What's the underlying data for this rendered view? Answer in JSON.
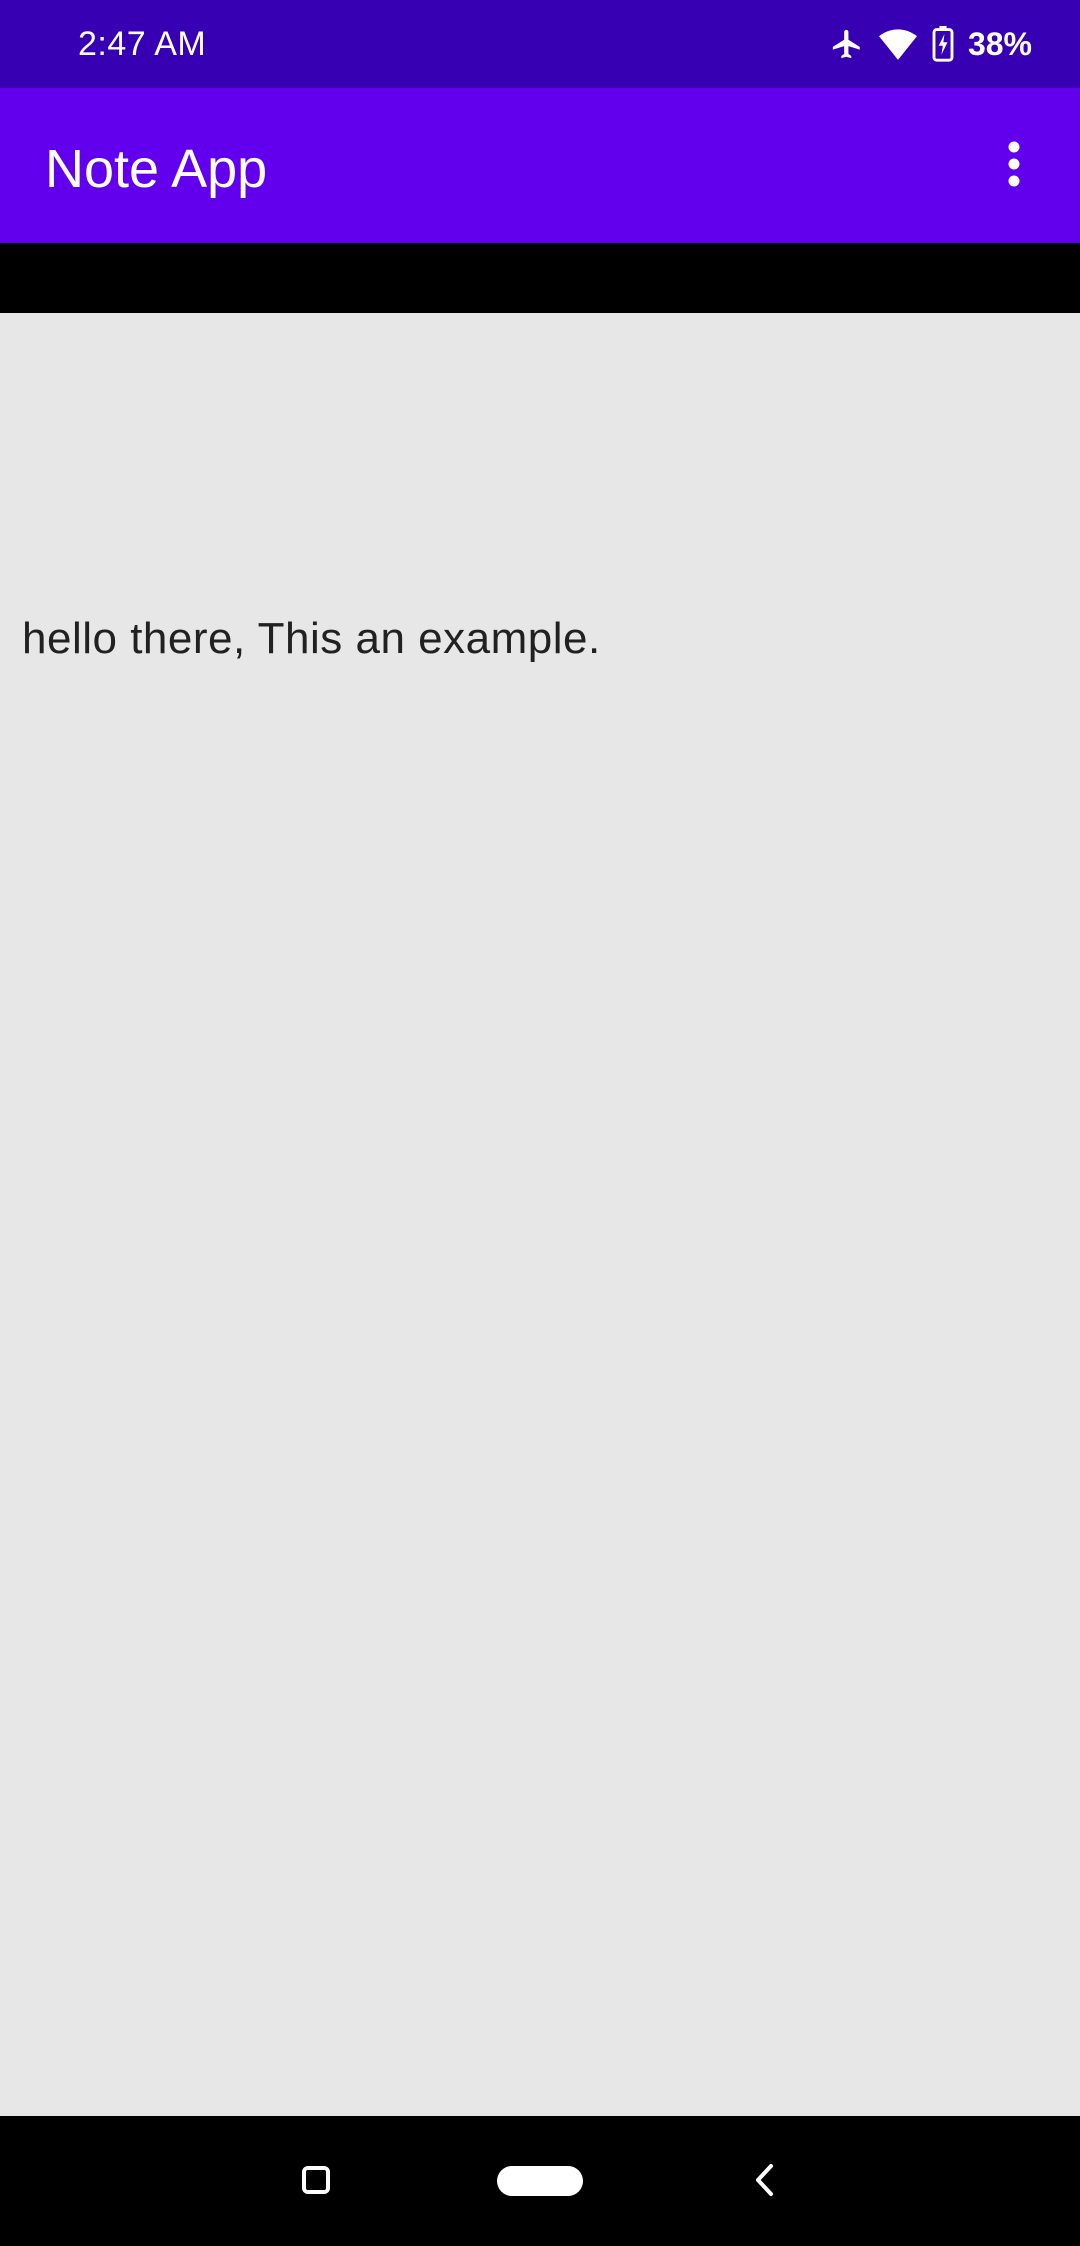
{
  "status_bar": {
    "time": "2:47 AM",
    "battery": "38%",
    "icons": [
      "airplane-mode-icon",
      "wifi-icon",
      "battery-charging-icon"
    ]
  },
  "app_bar": {
    "title": "Note App",
    "overflow_icon": "more-vert-icon"
  },
  "note": {
    "text": "hello there, This an example."
  },
  "nav_bar": {
    "icons": [
      "recents-icon",
      "home-pill-icon",
      "back-icon"
    ]
  },
  "colors": {
    "status_bar": "#3700b3",
    "app_bar": "#6200ee",
    "background": "#e7e7e7",
    "text": "#212121"
  }
}
